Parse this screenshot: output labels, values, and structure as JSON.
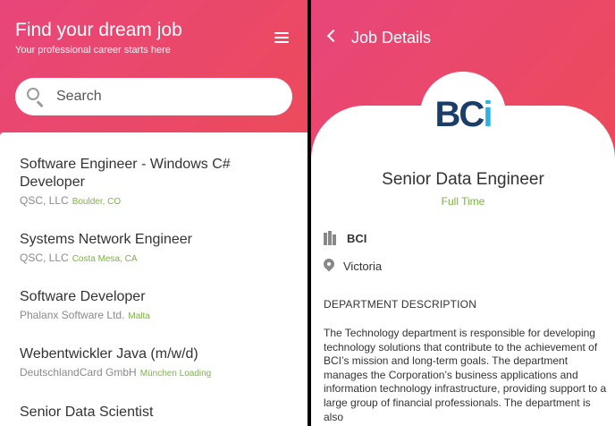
{
  "left": {
    "title": "Find your dream job",
    "subtitle": "Your professional career starts here",
    "search_placeholder": "Search",
    "jobs": [
      {
        "title": "Software Engineer - Windows C# Developer",
        "company": "QSC, LLC",
        "location": "Boulder, CO"
      },
      {
        "title": "Systems Network Engineer",
        "company": "QSC, LLC",
        "location": "Costa Mesa, CA"
      },
      {
        "title": "Software Developer",
        "company": "Phalanx Software Ltd.",
        "location": "Malta"
      },
      {
        "title": "Webentwickler Java (m/w/d)",
        "company": "DeutschlandCard GmbH",
        "location": "München Loading"
      },
      {
        "title": "Senior Data Scientist",
        "company": "",
        "location": ""
      }
    ]
  },
  "right": {
    "header_title": "Job Details",
    "logo_text": "BCi",
    "job_title": "Senior Data Engineer",
    "job_type": "Full Time",
    "company": "BCI",
    "location": "Victoria",
    "section_heading": "DEPARTMENT DESCRIPTION",
    "description": "The Technology department is responsible for developing technology solutions that contribute to the achievement of BCI’s mission and long-term goals. The department manages the Corporation’s business applications and information technology infrastructure, providing support to a large group of financial professionals. The department is also"
  },
  "colors": {
    "gradient_start": "#e8467a",
    "gradient_end": "#ef5a48",
    "accent_green": "#7cb342",
    "logo_blue": "#1b3d6a"
  }
}
